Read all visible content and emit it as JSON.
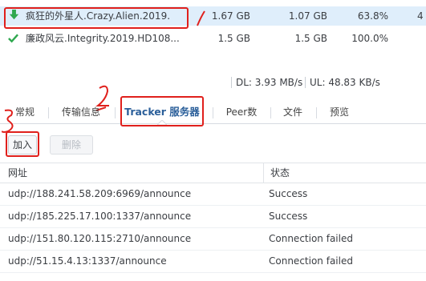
{
  "tasks": [
    {
      "name": "疯狂的外星人.Crazy.Alien.2019.",
      "size": "1.67 GB",
      "downloaded": "1.07 GB",
      "progress": "63.8%",
      "status_icon": "down-arrow-icon",
      "extra": "4"
    },
    {
      "name": "廉政风云.Integrity.2019.HD108...",
      "size": "1.5 GB",
      "downloaded": "1.5 GB",
      "progress": "100.0%",
      "status_icon": "check-icon",
      "extra": ""
    }
  ],
  "status_bar": {
    "dl": "DL: 3.93 MB/s",
    "ul": "UL: 48.83 KB/s"
  },
  "tabs": [
    "常规",
    "传输信息",
    "Tracker 服务器",
    "Peer数",
    "文件",
    "预览"
  ],
  "active_tab": "Tracker 服务器",
  "toolbar": {
    "add_label": "加入",
    "delete_label": "删除"
  },
  "tracker_table": {
    "headers": [
      "网址",
      "状态"
    ],
    "rows": [
      {
        "url": "udp://188.241.58.209:6969/announce",
        "status": "Success"
      },
      {
        "url": "udp://185.225.17.100:1337/announce",
        "status": "Success"
      },
      {
        "url": "udp://151.80.120.115:2710/announce",
        "status": "Connection failed"
      },
      {
        "url": "udp://51.15.4.13:1337/announce",
        "status": "Connection failed"
      }
    ]
  },
  "annotations": [
    "2",
    "3"
  ],
  "colors": {
    "accent": "#2b5f9a",
    "selected_row": "#dfeefb",
    "annotation_red": "#e0201c",
    "check_green": "#2fa84f"
  }
}
